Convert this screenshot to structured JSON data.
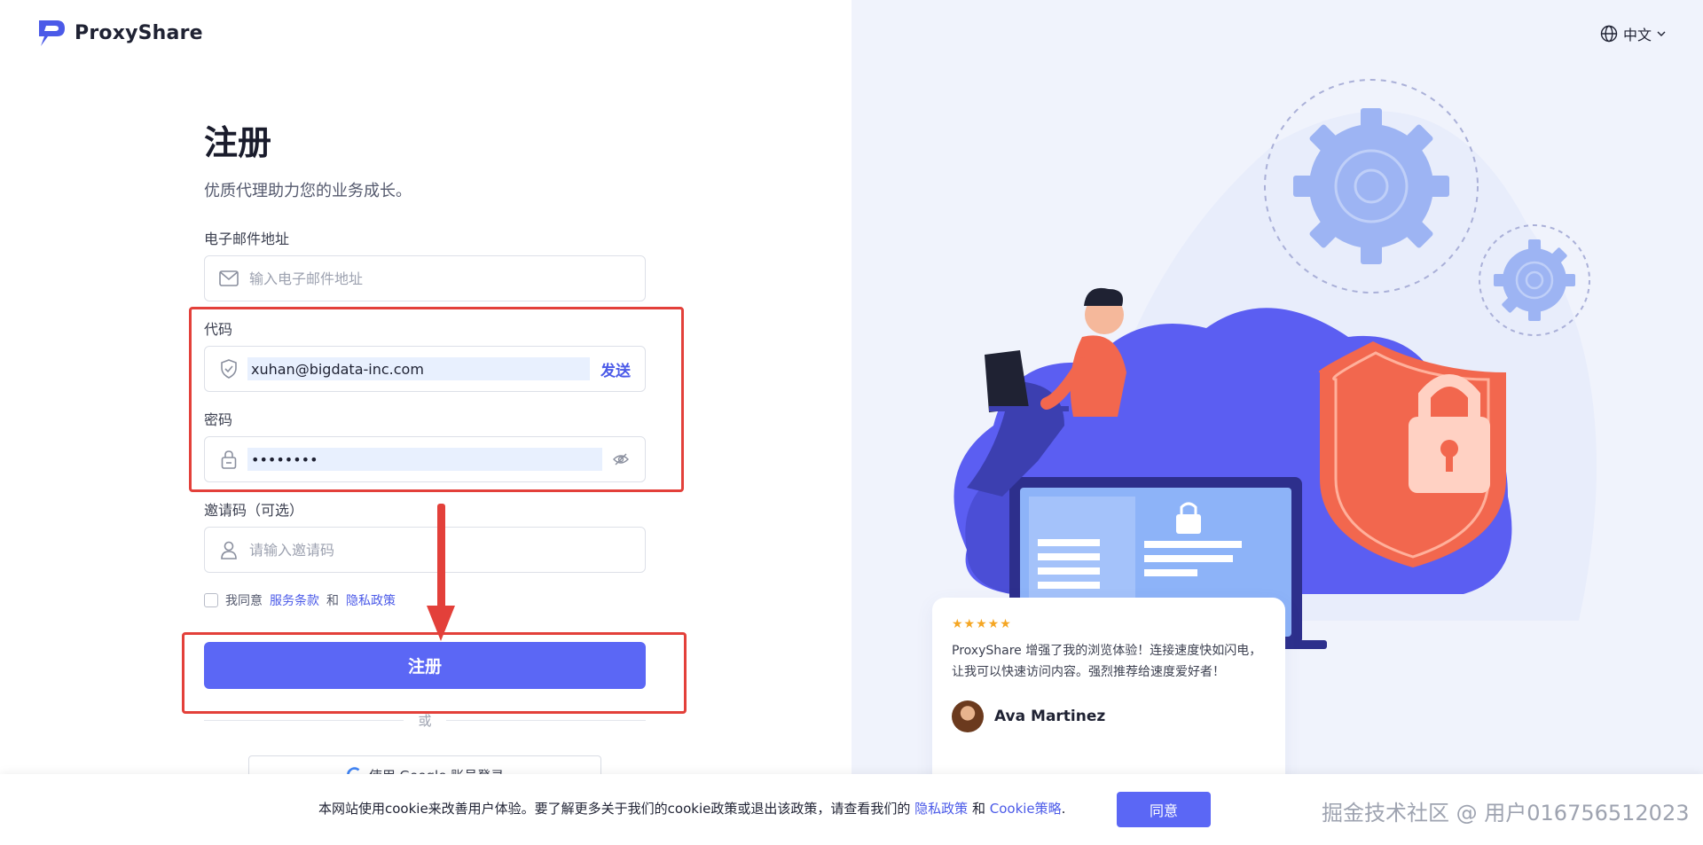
{
  "brand": {
    "name": "ProxyShare"
  },
  "language": {
    "current": "中文"
  },
  "form": {
    "title": "注册",
    "subtitle": "优质代理助力您的业务成长。",
    "email": {
      "label": "电子邮件地址",
      "placeholder": "输入电子邮件地址",
      "value": ""
    },
    "code": {
      "label": "代码",
      "value": "xuhan@bigdata-inc.com",
      "send_label": "发送"
    },
    "password": {
      "label": "密码",
      "value": "••••••••"
    },
    "invite": {
      "label": "邀请码（可选）",
      "placeholder": "请输入邀请码",
      "value": ""
    },
    "agree": {
      "prefix": "我同意",
      "terms": "服务条款",
      "and": "和",
      "privacy": "隐私政策"
    },
    "submit_label": "注册",
    "or_label": "或",
    "google_label": "使用 Google 账号登录"
  },
  "review": {
    "stars": "★★★★★",
    "text": "ProxyShare 增强了我的浏览体验！连接速度快如闪电，让我可以快速访问内容。强烈推荐给速度爱好者！",
    "name": "Ava Martinez"
  },
  "cookie": {
    "text": "本网站使用cookie来改善用户体验。要了解更多关于我们的cookie政策或退出该政策，请查看我们的",
    "privacy": "隐私政策",
    "and": "和",
    "cookie_policy": "Cookie策略",
    "period": ".",
    "agree_label": "同意"
  },
  "watermark": "掘金技术社区 @ 用户016756512023",
  "colors": {
    "accent": "#5b67f5",
    "annotation": "#e3403a",
    "right_bg": "#f0f3fc"
  }
}
